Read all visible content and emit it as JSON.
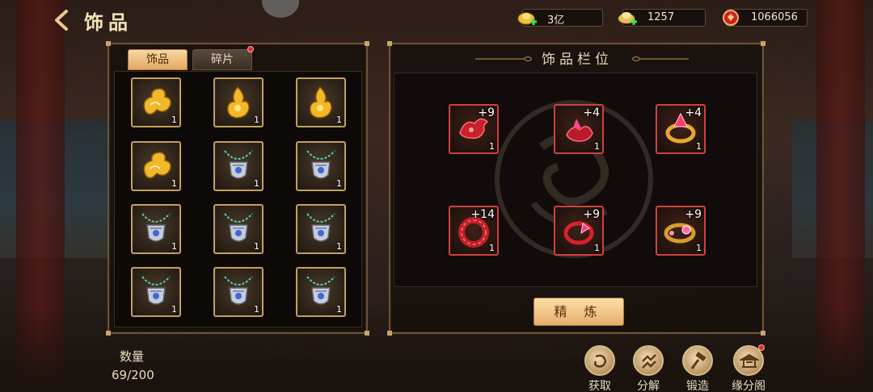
{
  "header": {
    "title": "饰品"
  },
  "currency": [
    {
      "icon": "gold-ingot-icon",
      "value": "3亿"
    },
    {
      "icon": "silver-ingot-icon",
      "value": "1257"
    },
    {
      "icon": "red-gem-icon",
      "value": "1066056"
    }
  ],
  "inventory": {
    "tabs": [
      {
        "label": "饰品",
        "active": true
      },
      {
        "label": "碎片",
        "active": false,
        "has_notification": true
      }
    ],
    "items": [
      {
        "icon": "gold-cloud-ornament-icon",
        "count": "1"
      },
      {
        "icon": "gold-flame-ornament-icon",
        "count": "1"
      },
      {
        "icon": "gold-flame-ornament-icon",
        "count": "1"
      },
      {
        "icon": "gold-cloud-ornament-icon",
        "count": "1"
      },
      {
        "icon": "silver-amulet-necklace-icon",
        "count": "1"
      },
      {
        "icon": "silver-amulet-necklace-icon",
        "count": "1"
      },
      {
        "icon": "silver-amulet-necklace-icon",
        "count": "1"
      },
      {
        "icon": "silver-amulet-necklace-icon",
        "count": "1"
      },
      {
        "icon": "silver-amulet-necklace-icon",
        "count": "1"
      },
      {
        "icon": "silver-amulet-necklace-icon",
        "count": "1"
      },
      {
        "icon": "silver-amulet-necklace-icon",
        "count": "1"
      },
      {
        "icon": "silver-amulet-necklace-icon",
        "count": "1"
      }
    ],
    "quantity_label": "数量",
    "quantity_value": "69/200"
  },
  "slots_panel": {
    "title": "饰品栏位",
    "slots": [
      {
        "icon": "red-phoenix-ornament-icon",
        "level": "+9",
        "count": "1"
      },
      {
        "icon": "red-crystal-brooch-icon",
        "level": "+4",
        "count": "1"
      },
      {
        "icon": "gold-gem-ring-icon",
        "level": "+4",
        "count": "1"
      },
      {
        "icon": "red-jade-ring-icon",
        "level": "+14",
        "count": "1"
      },
      {
        "icon": "red-crystal-ring-icon",
        "level": "+9",
        "count": "1"
      },
      {
        "icon": "gold-pink-gem-ring-icon",
        "level": "+9",
        "count": "1"
      }
    ],
    "refine_label": "精 炼"
  },
  "actions": [
    {
      "icon": "acquire-icon",
      "label": "获取"
    },
    {
      "icon": "decompose-icon",
      "label": "分解"
    },
    {
      "icon": "forge-hammer-icon",
      "label": "锻造"
    },
    {
      "icon": "pavilion-icon",
      "label": "缘分阁",
      "has_notification": true
    }
  ],
  "colors": {
    "gold_frame": "#c4a060",
    "red_frame": "#d04040",
    "button": "#e6ad6c",
    "notification": "#e02a2a"
  }
}
